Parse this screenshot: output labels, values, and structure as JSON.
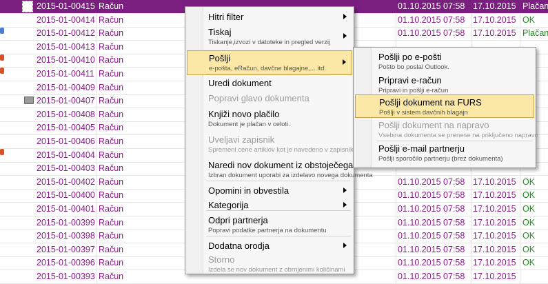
{
  "rows": [
    {
      "doc": "2015-01-00415",
      "type": "Račun",
      "date1": "01.10.2015 07:58",
      "date2": "17.10.2015",
      "status": "Plačan",
      "selected": true
    },
    {
      "doc": "2015-01-00414",
      "type": "Račun",
      "date1": "01.10.2015 07:58",
      "date2": "17.10.2015",
      "status": "OK"
    },
    {
      "doc": "2015-01-00412",
      "type": "Račun",
      "date1": "01.10.2015 07:58",
      "date2": "17.10.2015",
      "status": "Plačan"
    },
    {
      "doc": "2015-01-00413",
      "type": "Račun",
      "date1": "",
      "date2": "",
      "status": ""
    },
    {
      "doc": "2015-01-00410",
      "type": "Račun",
      "date1": "",
      "date2": "",
      "status": ""
    },
    {
      "doc": "2015-01-00411",
      "type": "Račun",
      "date1": "",
      "date2": "",
      "status": ""
    },
    {
      "doc": "2015-01-00409",
      "type": "Račun",
      "date1": "",
      "date2": "",
      "status": ""
    },
    {
      "doc": "2015-01-00407",
      "type": "Račun",
      "date1": "",
      "date2": "",
      "status": ""
    },
    {
      "doc": "2015-01-00408",
      "type": "Račun",
      "date1": "",
      "date2": "",
      "status": ""
    },
    {
      "doc": "2015-01-00405",
      "type": "Račun",
      "date1": "",
      "date2": "",
      "status": ""
    },
    {
      "doc": "2015-01-00406",
      "type": "Račun",
      "date1": "",
      "date2": "",
      "status": ""
    },
    {
      "doc": "2015-01-00404",
      "type": "Račun",
      "date1": "",
      "date2": "",
      "status": ""
    },
    {
      "doc": "2015-01-00403",
      "type": "Račun",
      "date1": "",
      "date2": "",
      "status": ""
    },
    {
      "doc": "2015-01-00402",
      "type": "Račun",
      "date1": "01.10.2015 07:58",
      "date2": "17.10.2015",
      "status": "OK"
    },
    {
      "doc": "2015-01-00400",
      "type": "Račun",
      "date1": "01.10.2015 07:58",
      "date2": "17.10.2015",
      "status": "OK"
    },
    {
      "doc": "2015-01-00401",
      "type": "Račun",
      "date1": "01.10.2015 07:58",
      "date2": "17.10.2015",
      "status": "OK"
    },
    {
      "doc": "2015-01-00399",
      "type": "Račun",
      "date1": "01.10.2015 07:58",
      "date2": "17.10.2015",
      "status": "OK"
    },
    {
      "doc": "2015-01-00398",
      "type": "Račun",
      "date1": "01.10.2015 07:58",
      "date2": "17.10.2015",
      "status": "OK"
    },
    {
      "doc": "2015-01-00397",
      "type": "Račun",
      "date1": "01.10.2015 07:58",
      "date2": "17.10.2015",
      "status": "OK"
    },
    {
      "doc": "2015-01-00396",
      "type": "Račun",
      "date1": "01.10.2015 07:58",
      "date2": "17.10.2015",
      "status": "OK"
    },
    {
      "doc": "2015-01-00393",
      "type": "Račun",
      "date1": "01.10.2015 07:58",
      "date2": "17.10.2015",
      "status": ""
    }
  ],
  "menu": {
    "items": [
      {
        "label": "Hitri filter",
        "sub": "",
        "arrow": true
      },
      {
        "label": "Tiskaj",
        "sub": "Tiskanje,izvozi v datoteke in pregled verzij",
        "arrow": true
      },
      {
        "label": "Pošlji",
        "sub": "e-pošta, eRačun, davčne blagajne,... itd.",
        "arrow": true,
        "highlight": true
      },
      {
        "label": "Uredi dokument",
        "sub": ""
      },
      {
        "label": "Popravi glavo dokumenta",
        "sub": "",
        "disabled": true
      },
      {
        "label": "Knjiži novo plačilo",
        "sub": "Dokument je plačan v celoti."
      },
      {
        "label": "Uveljavi zapisnik",
        "sub": "Spremeni cene artiklov kot je navedeno v zapisniku",
        "disabled": true
      },
      {
        "label": "Naredi nov dokument iz obstoječega",
        "sub": "Izbran dokument uporabi za izdelavo novega dokumenta"
      },
      {
        "label": "Opomini in obvestila",
        "sub": "",
        "arrow": true
      },
      {
        "label": "Kategorija",
        "sub": "",
        "arrow": true
      },
      {
        "label": "Odpri partnerja",
        "sub": "Popravi podatke partnerja na dokumentu"
      },
      {
        "label": "Dodatna orodja",
        "sub": "",
        "arrow": true
      },
      {
        "label": "Storno",
        "sub": "Izdela se nov dokument z obrnjenimi količinami",
        "disabled": true
      }
    ]
  },
  "submenu": {
    "items": [
      {
        "label": "Pošlji po e-pošti",
        "sub": "Pošto bo poslal Outlook."
      },
      {
        "label": "Pripravi e-račun",
        "sub": "Pripravi in pošlji e-račun"
      },
      {
        "label": "Pošlji dokument na FURS",
        "sub": "Pošlji v sistem davčnih blagajn",
        "highlight": true
      },
      {
        "label": "Pošlji dokument na napravo",
        "sub": "Vsebina dokumenta se prenese na priključeno napravo",
        "disabled": true
      },
      {
        "label": "Pošlji e-mail partnerju",
        "sub": "Pošlji sporočilo partnerju (brez dokumenta)"
      }
    ]
  },
  "colors": {
    "accent": "#7a1f80",
    "highlight": "#fbe8a6",
    "ok": "#1c8f1c",
    "text": "#8a1a8a"
  }
}
